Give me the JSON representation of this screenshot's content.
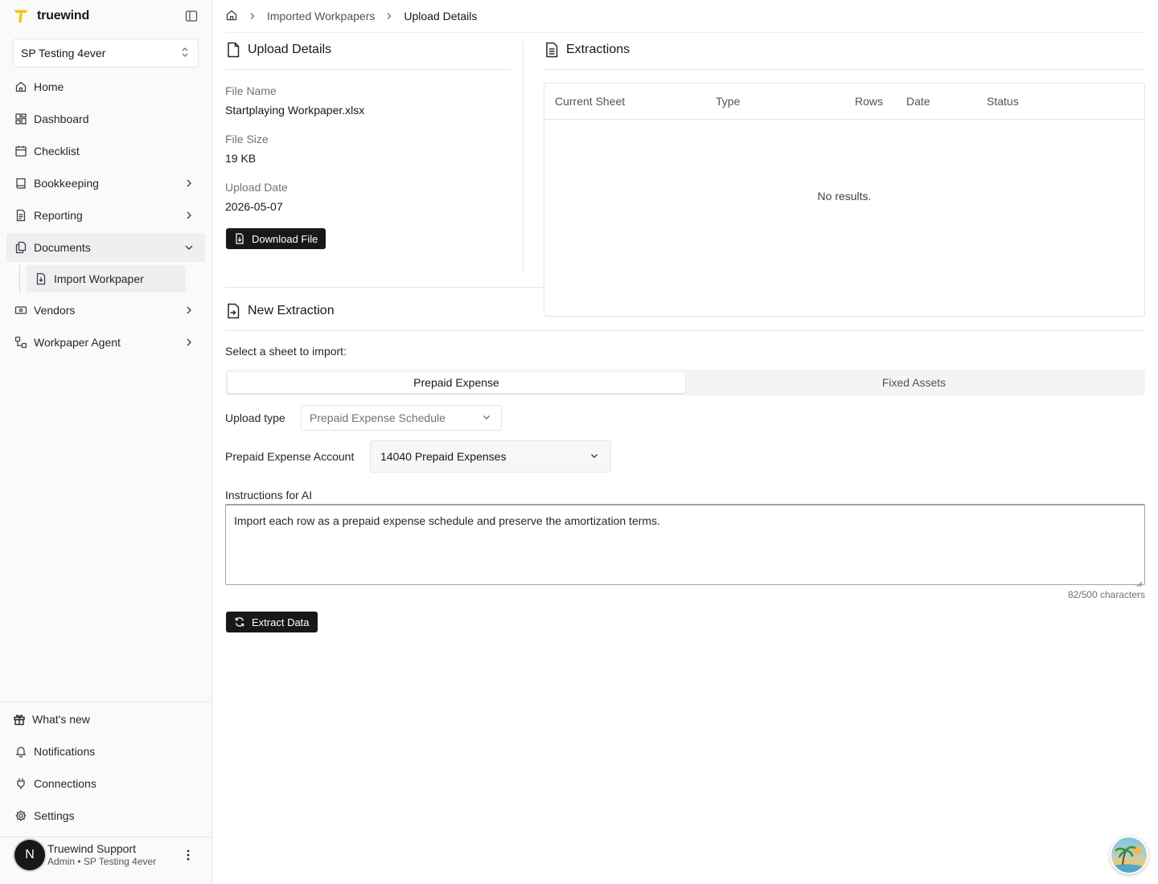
{
  "brand": {
    "name": "truewind",
    "accent": "#f5c518"
  },
  "org": {
    "selected": "SP Testing 4ever"
  },
  "nav": {
    "home": "Home",
    "dashboard": "Dashboard",
    "checklist": "Checklist",
    "bookkeeping": "Bookkeeping",
    "reporting": "Reporting",
    "documents": "Documents",
    "import_workpaper": "Import Workpaper",
    "vendors": "Vendors",
    "workpaper_agent": "Workpaper Agent"
  },
  "bottom_nav": {
    "whats_new": "What's new",
    "notifications": "Notifications",
    "connections": "Connections",
    "settings": "Settings"
  },
  "user": {
    "initial": "N",
    "name": "Truewind Support",
    "role": "Admin • SP Testing 4ever"
  },
  "breadcrumb": {
    "parent": "Imported Workpapers",
    "current": "Upload Details"
  },
  "upload_details": {
    "title": "Upload Details",
    "file_name_label": "File Name",
    "file_name": "Startplaying Workpaper.xlsx",
    "file_size_label": "File Size",
    "file_size": "19 KB",
    "upload_date_label": "Upload Date",
    "upload_date": "2026-05-07",
    "download_label": "Download File"
  },
  "extractions": {
    "title": "Extractions",
    "columns": [
      "Current Sheet",
      "Type",
      "Rows",
      "Date",
      "Status"
    ],
    "empty": "No results."
  },
  "new_extraction": {
    "title": "New Extraction",
    "sheet_prompt": "Select a sheet to import:",
    "tabs": [
      "Prepaid Expense",
      "Fixed Assets"
    ],
    "upload_type_label": "Upload type",
    "upload_type_value": "Prepaid Expense Schedule",
    "account_label": "Prepaid Expense Account",
    "account_value": "14040 Prepaid Expenses",
    "instructions_label": "Instructions for AI",
    "instructions_value": "Import each row as a prepaid expense schedule and preserve the amortization terms.",
    "char_count": "82/500 characters",
    "extract_label": "Extract Data"
  }
}
